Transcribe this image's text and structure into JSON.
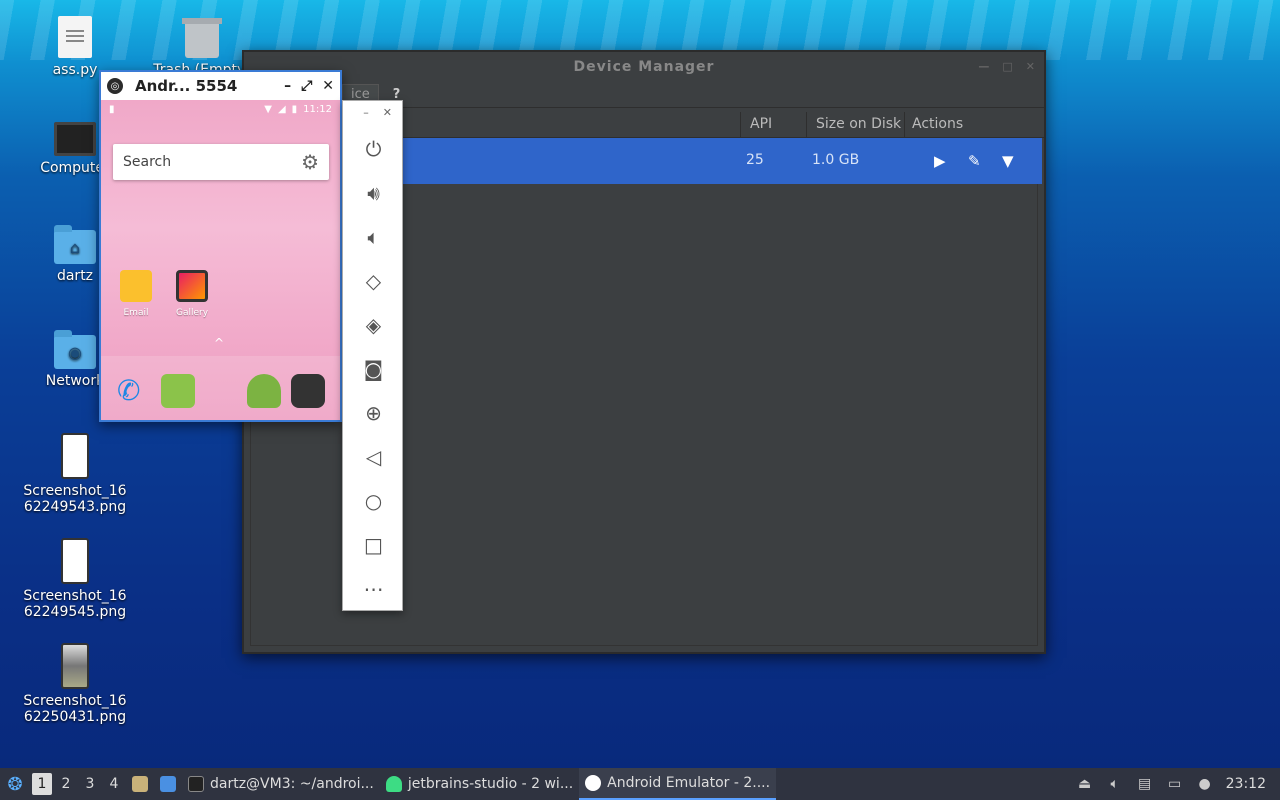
{
  "desktop": {
    "icons": [
      {
        "label": "ass.py",
        "icon": "text-file-icon"
      },
      {
        "label": "Trash (Empty)",
        "icon": "trash-icon"
      },
      {
        "label": "Computer",
        "icon": "computer-icon"
      },
      {
        "label": "dartz",
        "icon": "home-folder-icon"
      },
      {
        "label": "Network",
        "icon": "network-folder-icon"
      },
      {
        "label": "Screenshot_1662249543.png",
        "icon": "image-file-icon"
      },
      {
        "label": "Screenshot_1662249545.png",
        "icon": "image-file-icon"
      },
      {
        "label": "Screenshot_1662250431.png",
        "icon": "image-file-icon"
      }
    ]
  },
  "device_manager": {
    "title": "Device Manager",
    "tab_label": "ice",
    "help_label": "?",
    "columns": {
      "api": "API",
      "size": "Size on Disk",
      "actions": "Actions"
    },
    "row": {
      "api": "25",
      "size": "1.0 GB"
    }
  },
  "emulator": {
    "title": "Andr... 5554",
    "status_time": "11:12",
    "search_placeholder": "Search",
    "apps": [
      {
        "label": "Email"
      },
      {
        "label": "Gallery"
      }
    ],
    "drawer_arrow": "^"
  },
  "emulator_controls": [
    "power",
    "volume-up",
    "volume-down",
    "rotate-left",
    "rotate-right",
    "camera",
    "zoom",
    "back",
    "home",
    "overview",
    "more"
  ],
  "taskbar": {
    "workspaces": [
      "1",
      "2",
      "3",
      "4"
    ],
    "tasks": [
      {
        "label": "dartz@VM3: ~/androi...",
        "icon": "terminal-icon"
      },
      {
        "label": "jetbrains-studio - 2 wi...",
        "icon": "android-icon"
      },
      {
        "label": "Android Emulator - 2....",
        "icon": "emulator-icon"
      }
    ],
    "clock": "23:12"
  },
  "colors": {
    "accent": "#2f65ca",
    "emulator_border": "#3a7bd5",
    "taskbar": "#2f3340"
  }
}
